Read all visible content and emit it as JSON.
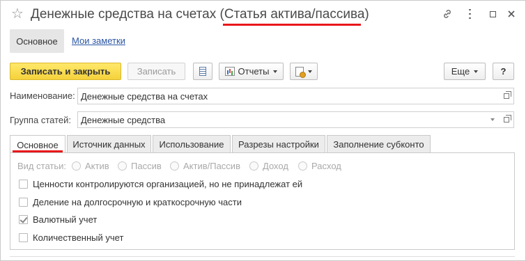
{
  "window": {
    "title_main": "Денежные средства на счетах ",
    "title_kind": "(Статья актива/пассива)"
  },
  "nav": {
    "main": "Основное",
    "notes": "Мои заметки"
  },
  "toolbar": {
    "save_close": "Записать и закрыть",
    "save": "Записать",
    "reports": "Отчеты",
    "more": "Еще",
    "help": "?"
  },
  "form": {
    "name_label": "Наименование:",
    "name_value": "Денежные средства на счетах",
    "group_label": "Группа статей:",
    "group_value": "Денежные средства"
  },
  "tabs": [
    {
      "label": "Основное"
    },
    {
      "label": "Источник данных"
    },
    {
      "label": "Использование"
    },
    {
      "label": "Разрезы настройки"
    },
    {
      "label": "Заполнение субконто"
    }
  ],
  "article_kind": {
    "label": "Вид статьи:",
    "options": [
      "Актив",
      "Пассив",
      "Актив/Пассив",
      "Доход",
      "Расход"
    ]
  },
  "flags": [
    {
      "label": "Ценности контролируются организацией, но не принадлежат ей",
      "checked": false
    },
    {
      "label": "Деление на долгосрочную и краткосрочную части",
      "checked": false
    },
    {
      "label": "Валютный учет",
      "checked": true
    },
    {
      "label": "Количественный учет",
      "checked": false
    }
  ],
  "colors": {
    "accent_underline": "#e8171a",
    "primary_button": "#f5d23c",
    "link": "#2a55a3"
  }
}
